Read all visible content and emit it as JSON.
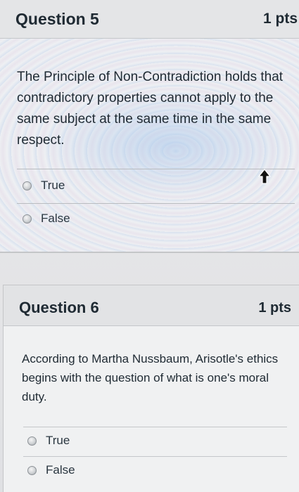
{
  "questions": [
    {
      "title": "Question 5",
      "points": "1 pts",
      "text": "The Principle of Non-Contradiction holds that contradictory properties cannot apply to the same subject at the same time in the same respect.",
      "answers": [
        "True",
        "False"
      ]
    },
    {
      "title": "Question 6",
      "points": "1 pts",
      "text": "According to Martha Nussbaum, Arisotle's ethics begins with the question of what is one's moral duty.",
      "answers": [
        "True",
        "False"
      ]
    }
  ],
  "icons": {
    "cursor": "mouse-pointer-icon",
    "radio": "radio-button"
  },
  "colors": {
    "text": "#1f2a33",
    "header_bg": "#e4e5e7",
    "divider": "#b9bcc0"
  }
}
